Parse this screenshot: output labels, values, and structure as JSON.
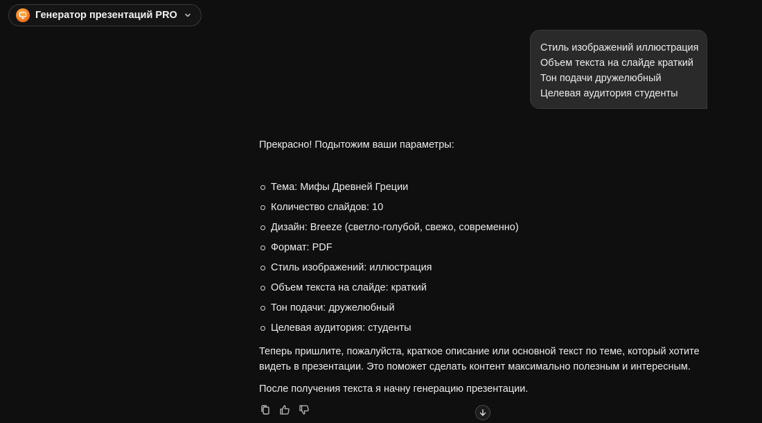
{
  "header": {
    "model_name": "Генератор презентаций PRO",
    "model_icon": "presentation-icon",
    "chevron_icon": "chevron-down-icon",
    "accent": "#f2711c"
  },
  "user_message": {
    "lines": [
      "Стиль изображений иллюстрация",
      "Объем текста на слайде краткий",
      "Тон подачи дружелюбный",
      "Целевая аудитория студенты"
    ]
  },
  "assistant_message": {
    "intro": "Прекрасно! Подытожим ваши параметры:",
    "params": [
      "Тема: Мифы Древней Греции",
      "Количество слайдов: 10",
      "Дизайн: Breeze (светло-голубой, свежо, современно)",
      "Формат: PDF",
      "Стиль изображений: иллюстрация",
      "Объем текста на слайде: краткий",
      "Тон подачи: дружелюбный",
      "Целевая аудитория: студенты"
    ],
    "paragraph1_line1": "Теперь пришлите, пожалуйста, краткое описание или основной текст по теме, который хотите",
    "paragraph1_line2": "видеть в презентации. Это поможет сделать контент максимально полезным и интересным.",
    "paragraph2": "После получения текста я начну генерацию презентации."
  },
  "actions": {
    "copy_icon": "copy-icon",
    "like_icon": "thumbs-up-icon",
    "dislike_icon": "thumbs-down-icon",
    "scroll_icon": "arrow-down-icon"
  }
}
